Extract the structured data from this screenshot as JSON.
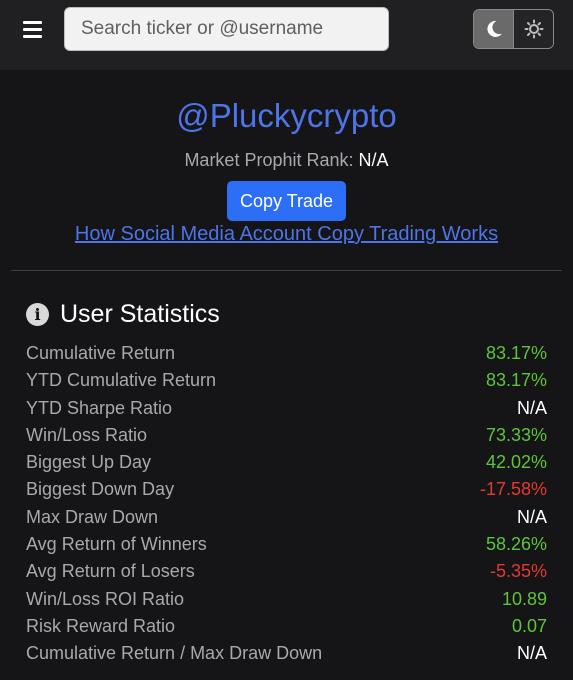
{
  "header": {
    "search_placeholder": "Search ticker or @username",
    "menu_icon": "hamburger-icon",
    "theme_dark_icon": "moon-icon",
    "theme_light_icon": "sun-icon"
  },
  "profile": {
    "username": "@Pluckycrypto",
    "rank_label": "Market Prophit Rank:",
    "rank_value": "N/A",
    "copy_trade_label": "Copy Trade",
    "howto_link": "How Social Media Account Copy Trading Works"
  },
  "stats": {
    "title": "User Statistics",
    "info_icon": "info-icon",
    "rows": [
      {
        "label": "Cumulative Return",
        "value": "83.17%",
        "tone": "pos"
      },
      {
        "label": "YTD Cumulative Return",
        "value": "83.17%",
        "tone": "pos"
      },
      {
        "label": "YTD Sharpe Ratio",
        "value": "N/A",
        "tone": "neutral"
      },
      {
        "label": "Win/Loss Ratio",
        "value": "73.33%",
        "tone": "pos"
      },
      {
        "label": "Biggest Up Day",
        "value": "42.02%",
        "tone": "pos"
      },
      {
        "label": "Biggest Down Day",
        "value": "-17.58%",
        "tone": "neg"
      },
      {
        "label": "Max Draw Down",
        "value": "N/A",
        "tone": "neutral"
      },
      {
        "label": "Avg Return of Winners",
        "value": "58.26%",
        "tone": "pos"
      },
      {
        "label": "Avg Return of Losers",
        "value": "-5.35%",
        "tone": "neg"
      },
      {
        "label": "Win/Loss ROI Ratio",
        "value": "10.89",
        "tone": "pos"
      },
      {
        "label": "Risk Reward Ratio",
        "value": "0.07",
        "tone": "pos"
      },
      {
        "label": "Cumulative Return / Max Draw Down",
        "value": "N/A",
        "tone": "neutral"
      }
    ]
  },
  "colors": {
    "background": "#151517",
    "header_bg": "#202023",
    "accent_link": "#4d74e8",
    "button": "#2d6ef6",
    "positive": "#5ec43a",
    "negative": "#e53a2e"
  }
}
